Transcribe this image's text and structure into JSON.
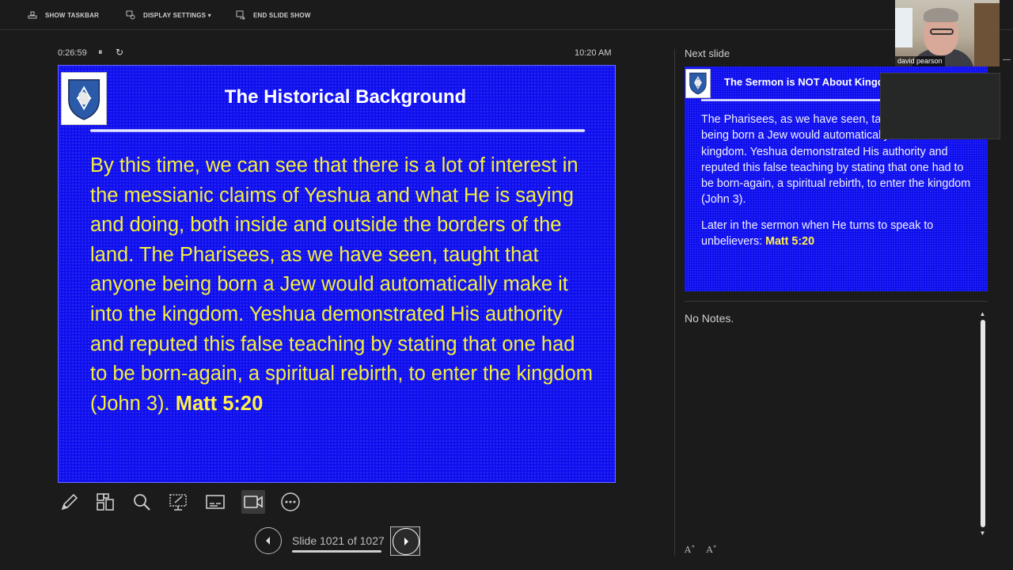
{
  "toolbar": {
    "show_taskbar": "SHOW TASKBAR",
    "display_settings": "DISPLAY SETTINGS ▾",
    "end_slide_show": "END SLIDE SHOW"
  },
  "status": {
    "elapsed": "0:26:59",
    "pause_icon": "⏸",
    "restart_icon": "↻",
    "clock": "10:20 AM"
  },
  "current_slide": {
    "title": "The Historical Background",
    "body": "By this time, we can see that there is a lot of interest in the messianic claims of Yeshua and what He is saying and doing, both inside and outside the borders of the land.  The Pharisees, as we have seen, taught that anyone being born a Jew would automatically make it into the kingdom.  Yeshua demonstrated His authority and reputed this false teaching by stating that one had to be born-again, a spiritual rebirth, to enter the kingdom (John 3). ",
    "reference": "Matt 5:20",
    "background_color": "#1010ee",
    "text_color": "#f5ef3a"
  },
  "tools": {
    "pen": "pen-icon",
    "see_all_slides": "grid-icon",
    "zoom": "magnifier-icon",
    "pointer": "laser-pointer-icon",
    "subtitles": "subtitles-icon",
    "camera": "camera-icon",
    "more": "more-options-icon"
  },
  "navigation": {
    "counter": "Slide 1021 of 1027",
    "current": 1021,
    "total": 1027
  },
  "next_slide": {
    "label": "Next slide",
    "title": "The Sermon is NOT About Kingdom",
    "para1": "The Pharisees, as we have seen, taught that anyone being born a Jew would automatically make it into the kingdom.  Yeshua demonstrated His authority and reputed this false teaching by stating that one had to be born-again, a spiritual rebirth, to enter the kingdom (John 3).",
    "para2": "Later in the sermon when He turns to speak to unbelievers: ",
    "para2_ref": "Matt 5:20"
  },
  "notes": {
    "text": "No Notes."
  },
  "font_controls": {
    "increase": "A˄",
    "decrease": "A˅"
  },
  "webcam": {
    "name": "david pearson",
    "minimize": "—"
  }
}
